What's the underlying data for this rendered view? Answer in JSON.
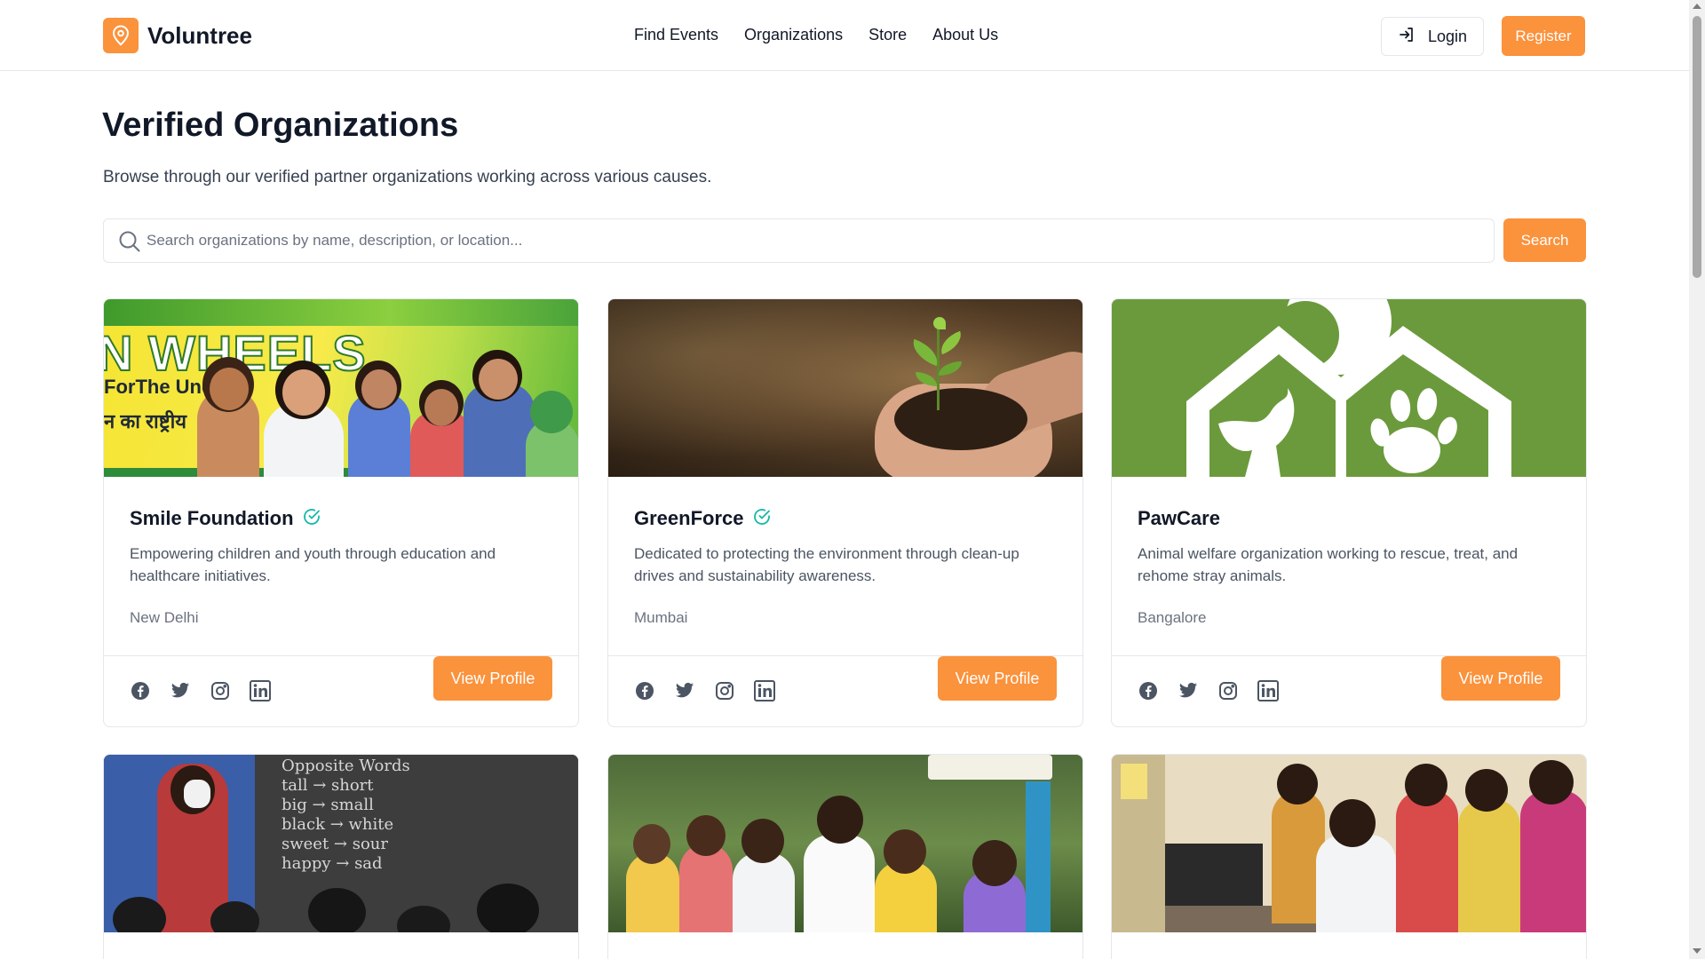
{
  "brand": {
    "name": "Voluntree",
    "accent": "#fb923c"
  },
  "nav": {
    "items": [
      {
        "label": "Find Events"
      },
      {
        "label": "Organizations"
      },
      {
        "label": "Store"
      },
      {
        "label": "About Us"
      }
    ],
    "login_label": "Login",
    "register_label": "Register"
  },
  "page": {
    "title": "Verified Organizations",
    "subtitle": "Browse through our verified partner organizations working across various causes."
  },
  "search": {
    "placeholder": "Search organizations by name, description, or location...",
    "value": "",
    "button_label": "Search"
  },
  "organizations": [
    {
      "name": "Smile Foundation",
      "verified": true,
      "description": "Empowering children and youth through education and healthcare initiatives.",
      "location": "New Delhi",
      "button_label": "View Profile",
      "image": {
        "caption_line1": "N WHEELS",
        "caption_line2": "ForThe Unde",
        "caption_line3": "न का राष्ट्रीय"
      }
    },
    {
      "name": "GreenForce",
      "verified": true,
      "description": "Dedicated to protecting the environment through clean-up drives and sustainability awareness.",
      "location": "Mumbai",
      "button_label": "View Profile"
    },
    {
      "name": "PawCare",
      "verified": false,
      "description": "Animal welfare organization working to rescue, treat, and rehome stray animals.",
      "location": "Bangalore",
      "button_label": "View Profile"
    }
  ],
  "row2_images": [
    {
      "board_text": [
        "Opposite Words",
        "tall → short",
        "big → small",
        "black → white",
        "sweet → sour",
        "happy → sad"
      ]
    },
    {},
    {}
  ],
  "icons": {
    "logo": "map-pin-icon",
    "login": "log-in-icon",
    "search": "search-icon",
    "verified": "check-circle-icon",
    "socials": [
      "facebook-icon",
      "twitter-icon",
      "instagram-icon",
      "linkedin-icon"
    ]
  }
}
